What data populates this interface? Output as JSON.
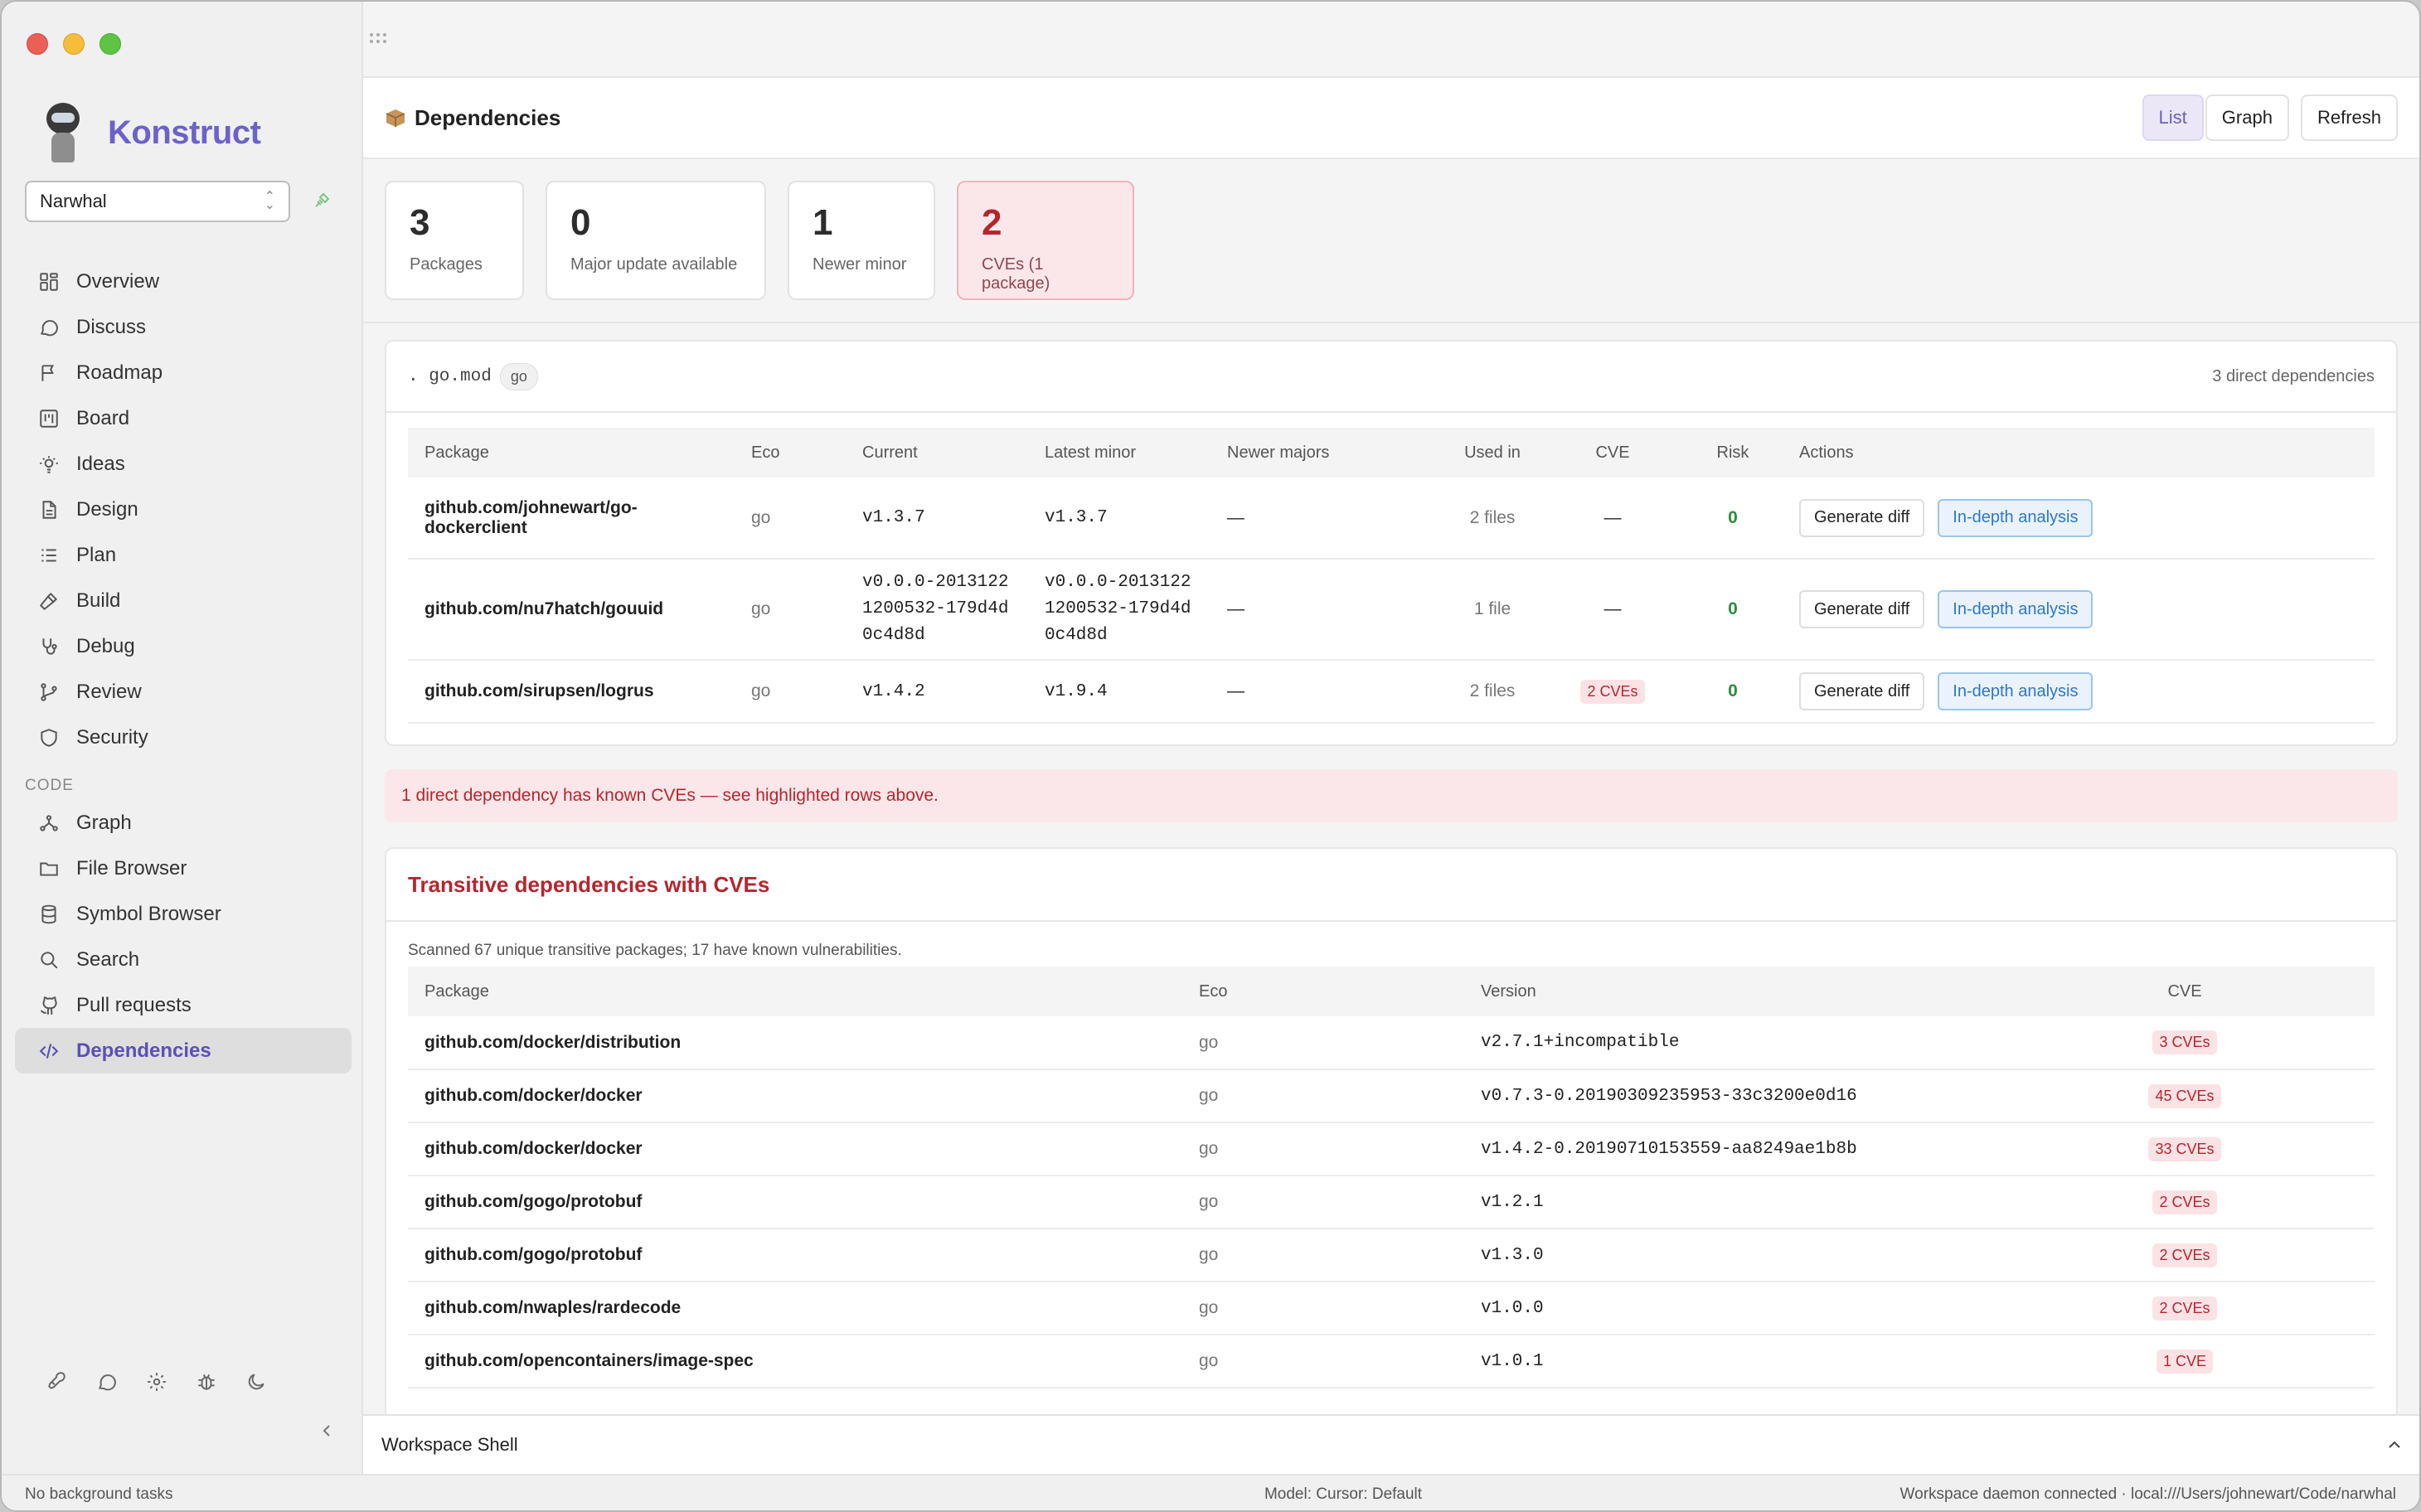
{
  "app": {
    "name": "Konstruct",
    "project": "Narwhal"
  },
  "sidebar": {
    "items": [
      {
        "label": "Overview",
        "icon": "grid-icon"
      },
      {
        "label": "Discuss",
        "icon": "chat-icon"
      },
      {
        "label": "Roadmap",
        "icon": "flag-icon"
      },
      {
        "label": "Board",
        "icon": "kanban-icon"
      },
      {
        "label": "Ideas",
        "icon": "lightbulb-icon"
      },
      {
        "label": "Design",
        "icon": "document-icon"
      },
      {
        "label": "Plan",
        "icon": "list-icon"
      },
      {
        "label": "Build",
        "icon": "hammer-icon"
      },
      {
        "label": "Debug",
        "icon": "stethoscope-icon"
      },
      {
        "label": "Review",
        "icon": "git-branch-icon"
      },
      {
        "label": "Security",
        "icon": "shield-icon"
      }
    ],
    "code_section_label": "CODE",
    "code_items": [
      {
        "label": "Graph",
        "icon": "graph-icon"
      },
      {
        "label": "File Browser",
        "icon": "folder-icon"
      },
      {
        "label": "Symbol Browser",
        "icon": "database-icon"
      },
      {
        "label": "Search",
        "icon": "search-icon"
      },
      {
        "label": "Pull requests",
        "icon": "github-icon"
      },
      {
        "label": "Dependencies",
        "icon": "code-icon",
        "active": true
      }
    ]
  },
  "header": {
    "title": "Dependencies",
    "buttons": {
      "list": "List",
      "graph": "Graph",
      "refresh": "Refresh"
    }
  },
  "stats": [
    {
      "value": "3",
      "label": "Packages"
    },
    {
      "value": "0",
      "label": "Major update available"
    },
    {
      "value": "1",
      "label": "Newer minor"
    },
    {
      "value": "2",
      "label": "CVEs (1 package)",
      "danger": true
    }
  ],
  "gomod": {
    "file": ". go.mod",
    "ecosystem": "go",
    "summary": "3 direct dependencies",
    "columns": [
      "Package",
      "Eco",
      "Current",
      "Latest minor",
      "Newer majors",
      "Used in",
      "CVE",
      "Risk",
      "Actions"
    ],
    "rows": [
      {
        "package": "github.com/johnewart/go-dockerclient",
        "eco": "go",
        "current": "v1.3.7",
        "latest": "v1.3.7",
        "majors": "—",
        "used": "2 files",
        "cve": "—",
        "risk": "0"
      },
      {
        "package": "github.com/nu7hatch/gouuid",
        "eco": "go",
        "current": "v0.0.0-20131221200532-179d4d0c4d8d",
        "latest": "v0.0.0-20131221200532-179d4d0c4d8d",
        "majors": "—",
        "used": "1 file",
        "cve": "—",
        "risk": "0"
      },
      {
        "package": "github.com/sirupsen/logrus",
        "eco": "go",
        "current": "v1.4.2",
        "latest": "v1.9.4",
        "majors": "—",
        "used": "2 files",
        "cve": "2 CVEs",
        "risk": "0"
      }
    ],
    "actions": {
      "diff": "Generate diff",
      "analysis": "In-depth analysis"
    }
  },
  "alert": "1 direct dependency has known CVEs — see highlighted rows above.",
  "transitive": {
    "title": "Transitive dependencies with CVEs",
    "note": "Scanned 67 unique transitive packages; 17 have known vulnerabilities.",
    "columns": [
      "Package",
      "Eco",
      "Version",
      "CVE"
    ],
    "rows": [
      {
        "package": "github.com/docker/distribution",
        "eco": "go",
        "version": "v2.7.1+incompatible",
        "cve": "3 CVEs"
      },
      {
        "package": "github.com/docker/docker",
        "eco": "go",
        "version": "v0.7.3-0.20190309235953-33c3200e0d16",
        "cve": "45 CVEs"
      },
      {
        "package": "github.com/docker/docker",
        "eco": "go",
        "version": "v1.4.2-0.20190710153559-aa8249ae1b8b",
        "cve": "33 CVEs"
      },
      {
        "package": "github.com/gogo/protobuf",
        "eco": "go",
        "version": "v1.2.1",
        "cve": "2 CVEs"
      },
      {
        "package": "github.com/gogo/protobuf",
        "eco": "go",
        "version": "v1.3.0",
        "cve": "2 CVEs"
      },
      {
        "package": "github.com/nwaples/rardecode",
        "eco": "go",
        "version": "v1.0.0",
        "cve": "2 CVEs"
      },
      {
        "package": "github.com/opencontainers/image-spec",
        "eco": "go",
        "version": "v1.0.1",
        "cve": "1 CVE"
      }
    ]
  },
  "shell": {
    "title": "Workspace Shell"
  },
  "status": {
    "left": "No background tasks",
    "center": "Model: Cursor: Default",
    "right": "Workspace daemon connected · local:///Users/johnewart/Code/narwhal"
  },
  "colors": {
    "accent": "#6b62c9",
    "danger": "#b3262f",
    "ok": "#2e8b3e",
    "link": "#2f78c4"
  }
}
